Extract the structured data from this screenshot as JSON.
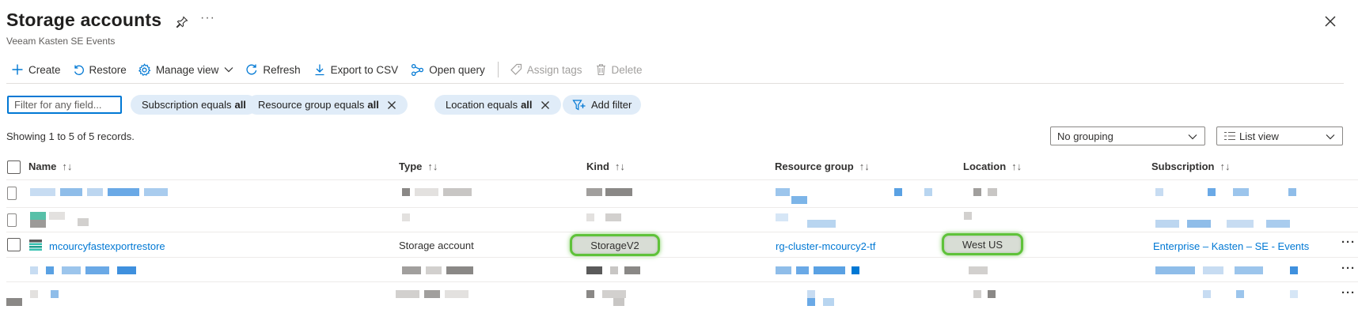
{
  "page": {
    "title": "Storage accounts",
    "subtitle": "Veeam Kasten SE Events"
  },
  "toolbar": {
    "create": "Create",
    "restore": "Restore",
    "manage_view": "Manage view",
    "refresh": "Refresh",
    "export_csv": "Export to CSV",
    "open_query": "Open query",
    "assign_tags": "Assign tags",
    "delete": "Delete"
  },
  "filters": {
    "placeholder": "Filter for any field...",
    "subscription": {
      "label": "Subscription equals",
      "value": "all"
    },
    "resource_group": {
      "label": "Resource group equals",
      "value": "all"
    },
    "location": {
      "label": "Location equals",
      "value": "all"
    },
    "add_filter": "Add filter"
  },
  "records_text": "Showing 1 to 5 of 5 records.",
  "grouping": "No grouping",
  "view_mode": "List view",
  "columns": {
    "name": "Name",
    "type": "Type",
    "kind": "Kind",
    "resource_group": "Resource group",
    "location": "Location",
    "subscription": "Subscription"
  },
  "visible_row": {
    "name": "mcourcyfastexportrestore",
    "type": "Storage account",
    "kind": "StorageV2",
    "resource_group": "rg-cluster-mcourcy2-tf",
    "location": "West US",
    "subscription": "Enterprise – Kasten – SE - Events"
  },
  "row_more": "···",
  "colors": {
    "accent": "#0078d4",
    "pill_bg": "#e0ecf8",
    "highlight": "#5fc23a"
  }
}
